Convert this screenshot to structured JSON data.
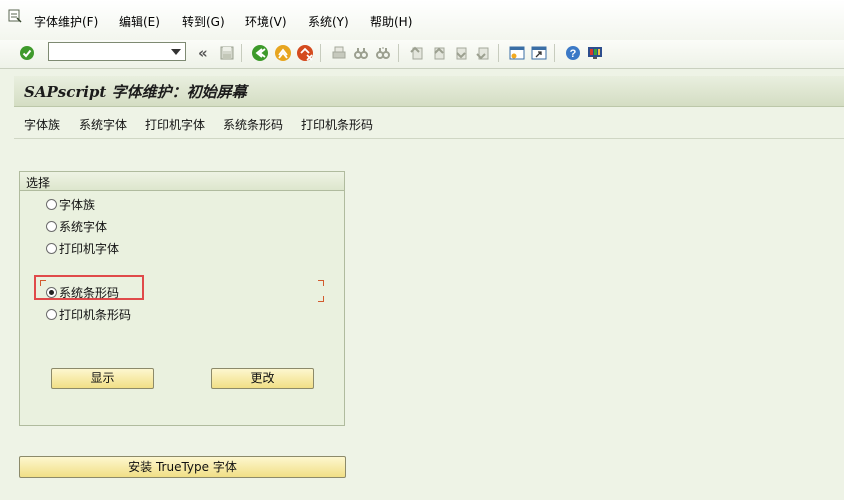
{
  "menubar": {
    "items": [
      {
        "label": "字体维护(F)"
      },
      {
        "label": "编辑(E)"
      },
      {
        "label": "转到(G)"
      },
      {
        "label": "环境(V)"
      },
      {
        "label": "系统(Y)"
      },
      {
        "label": "帮助(H)"
      }
    ]
  },
  "toolbar": {
    "command_value": "",
    "icons": [
      "enter-check-icon",
      "save-icon",
      "back-icon",
      "exit-icon",
      "cancel-icon",
      "print-icon",
      "find-icon",
      "find-next-icon",
      "first-page-icon",
      "previous-page-icon",
      "next-page-icon",
      "last-page-icon",
      "create-session-icon",
      "shortcut-icon",
      "help-icon",
      "customize-layout-icon"
    ]
  },
  "page": {
    "title": "SAPscript 字体维护：初始屏幕",
    "app_buttons": [
      "字体族",
      "系统字体",
      "打印机字体",
      "系统条形码",
      "打印机条形码"
    ]
  },
  "selection": {
    "title": "选择",
    "options": [
      {
        "label": "字体族",
        "checked": false
      },
      {
        "label": "系统字体",
        "checked": false
      },
      {
        "label": "打印机字体",
        "checked": false
      },
      {
        "label": "系统条形码",
        "checked": true
      },
      {
        "label": "打印机条形码",
        "checked": false
      }
    ],
    "display_label": "显示",
    "change_label": "更改"
  },
  "install_label": "安装 TrueType 字体",
  "colors": {
    "background": "#eef3e6",
    "highlight": "#e04a4a",
    "button": "#f1df86"
  }
}
